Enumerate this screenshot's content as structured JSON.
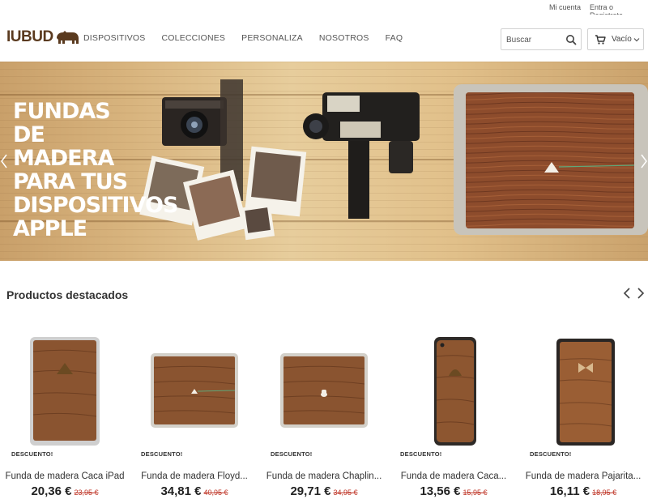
{
  "topbar": {
    "account": "Mi cuenta",
    "login": "Entra o Registrate"
  },
  "header": {
    "logo": "IUBUD",
    "nav": [
      "DISPOSITIVOS",
      "COLECCIONES",
      "PERSONALIZA",
      "NOSOTROS",
      "FAQ"
    ],
    "search_placeholder": "Buscar",
    "cart_label": "Vacío"
  },
  "hero": {
    "title_lines": [
      "FUNDAS",
      "DE MADERA",
      "PARA TUS",
      "DISPOSITIVOS",
      "APPLE"
    ]
  },
  "featured": {
    "title": "Productos destacados",
    "products": [
      {
        "badge": "DESCUENTO!",
        "name": "Funda de madera Caca iPad",
        "price": "20,36 €",
        "old_price": "23,95 €",
        "device": "ipad",
        "motif": "poop"
      },
      {
        "badge": "DESCUENTO!",
        "name": "Funda de madera Floyd...",
        "price": "34,81 €",
        "old_price": "40,95 €",
        "device": "macbook",
        "motif": "prism"
      },
      {
        "badge": "DESCUENTO!",
        "name": "Funda de madera Chaplin...",
        "price": "29,71 €",
        "old_price": "34,95 €",
        "device": "macbook",
        "motif": "hat"
      },
      {
        "badge": "DESCUENTO!",
        "name": "Funda de madera Caca...",
        "price": "13,56 €",
        "old_price": "15,95 €",
        "device": "iphone",
        "motif": "poop"
      },
      {
        "badge": "DESCUENTO!",
        "name": "Funda de madera Pajarita...",
        "price": "16,11 €",
        "old_price": "18,95 €",
        "device": "ipad-mini",
        "motif": "bowtie"
      }
    ]
  },
  "colors": {
    "wood_dark": "#6b3c1d",
    "wood_mid": "#8a5430",
    "accent_price_old": "#c0392b",
    "logo": "#5a3a1f"
  }
}
